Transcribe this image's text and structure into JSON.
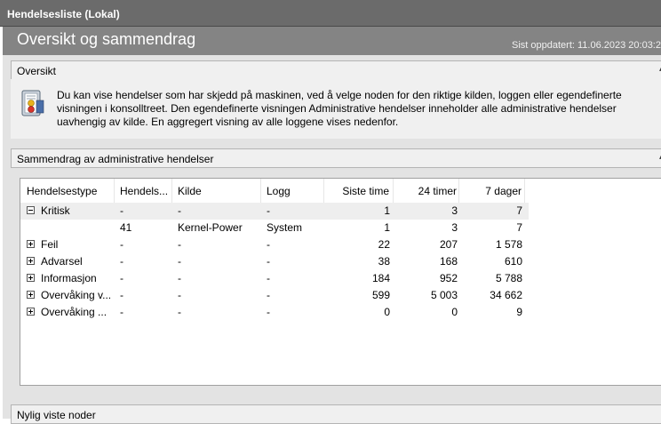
{
  "window": {
    "title": "Hendelsesliste (Lokal)"
  },
  "header": {
    "title": "Oversikt og sammendrag",
    "last_updated": "Sist oppdatert: 11.06.2023 20:03:2"
  },
  "overview": {
    "label": "Oversikt",
    "text": "Du kan vise hendelser som har skjedd på maskinen, ved å velge noden for den riktige kilden, loggen eller egendefinerte visningen i konsolltreet. Den egendefinerte visningen Administrative hendelser inneholder alle administrative hendelser uavhengig av kilde. En aggregert visning av alle loggene vises nedenfor."
  },
  "summary": {
    "label": "Sammendrag av administrative hendelser",
    "columns": [
      "Hendelsestype",
      "Hendels...",
      "Kilde",
      "Logg",
      "Siste time",
      "24 timer",
      "7 dager"
    ],
    "rows": [
      {
        "type": "Kritisk",
        "id": "-",
        "source": "-",
        "log": "-",
        "last_hour": "1",
        "h24": "3",
        "d7": "7",
        "expander": "minus"
      },
      {
        "type": "",
        "id": "41",
        "source": "Kernel-Power",
        "log": "System",
        "last_hour": "1",
        "h24": "3",
        "d7": "7",
        "expander": "none"
      },
      {
        "type": "Feil",
        "id": "-",
        "source": "-",
        "log": "-",
        "last_hour": "22",
        "h24": "207",
        "d7": "1 578",
        "expander": "plus"
      },
      {
        "type": "Advarsel",
        "id": "-",
        "source": "-",
        "log": "-",
        "last_hour": "38",
        "h24": "168",
        "d7": "610",
        "expander": "plus"
      },
      {
        "type": "Informasjon",
        "id": "-",
        "source": "-",
        "log": "-",
        "last_hour": "184",
        "h24": "952",
        "d7": "5 788",
        "expander": "plus"
      },
      {
        "type": "Overvåking v...",
        "id": "-",
        "source": "-",
        "log": "-",
        "last_hour": "599",
        "h24": "5 003",
        "d7": "34 662",
        "expander": "plus"
      },
      {
        "type": "Overvåking ...",
        "id": "-",
        "source": "-",
        "log": "-",
        "last_hour": "0",
        "h24": "0",
        "d7": "9",
        "expander": "plus"
      }
    ]
  },
  "recent_nodes": {
    "label": "Nylig viste noder"
  },
  "icons": {
    "overview": "event-log-icon",
    "collapse": "chevron-up-icon"
  }
}
